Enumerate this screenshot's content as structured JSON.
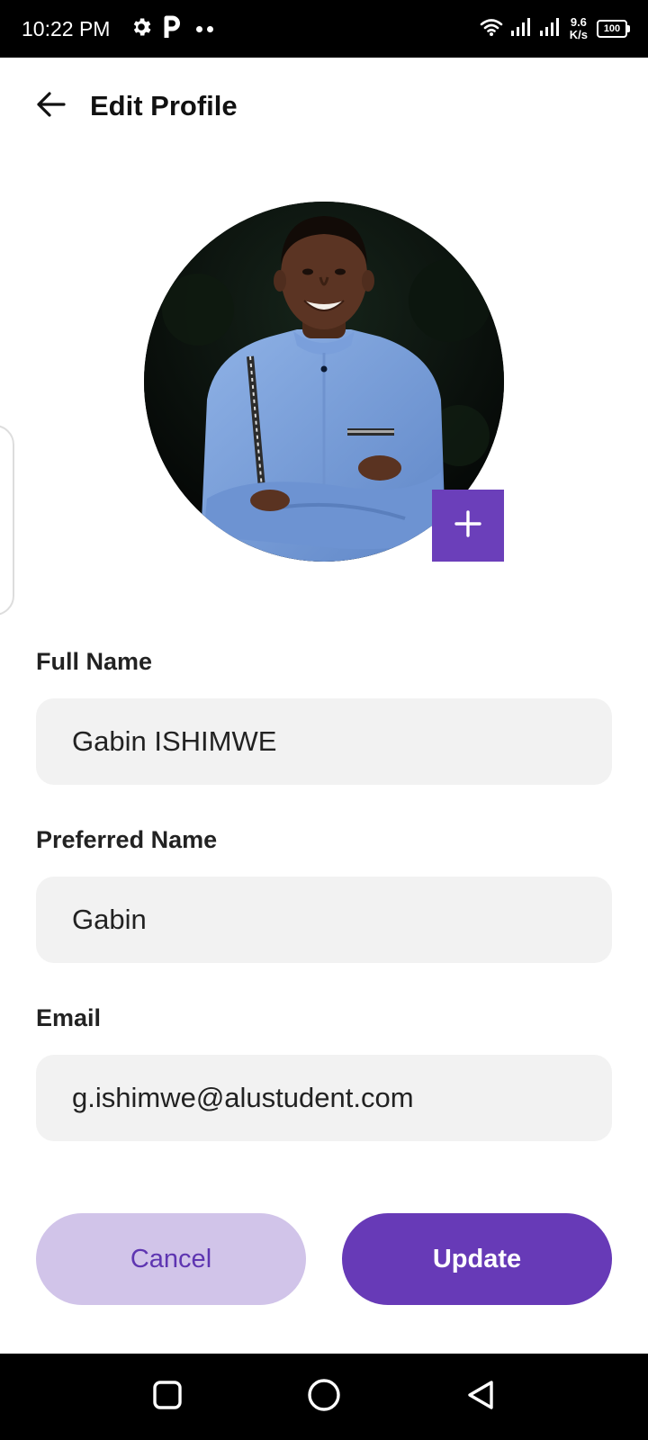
{
  "status_bar": {
    "time": "10:22 PM",
    "net_speed_value": "9.6",
    "net_speed_unit": "K/s",
    "battery_level": "100"
  },
  "header": {
    "title": "Edit Profile",
    "back_icon": "arrow-left-icon"
  },
  "avatar": {
    "add_icon": "plus-icon",
    "add_button_color": "#6b3fba"
  },
  "form": {
    "full_name": {
      "label": "Full Name",
      "value": "Gabin ISHIMWE"
    },
    "preferred_name": {
      "label": "Preferred Name",
      "value": "Gabin"
    },
    "email": {
      "label": "Email",
      "value": "g.ishimwe@alustudent.com"
    }
  },
  "actions": {
    "cancel_label": "Cancel",
    "update_label": "Update"
  },
  "colors": {
    "accent": "#673ab7",
    "accent_light": "#d1c4e9",
    "input_bg": "#f2f2f2"
  },
  "nav_bar": {
    "recents_icon": "square-icon",
    "home_icon": "circle-icon",
    "back_icon": "triangle-back-icon"
  }
}
